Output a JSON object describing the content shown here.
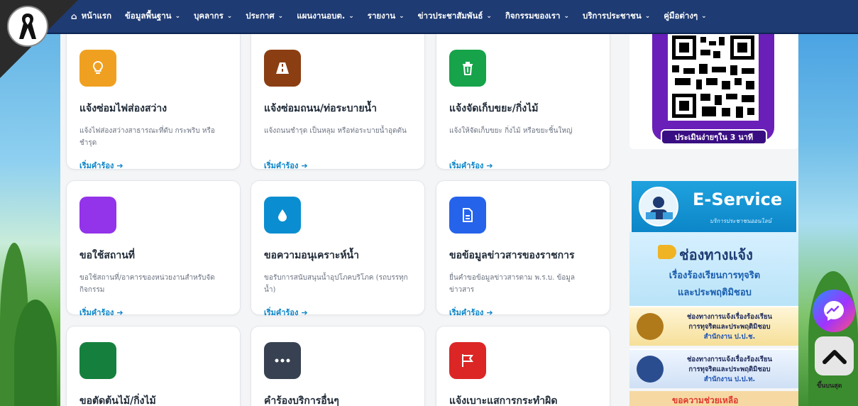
{
  "nav": {
    "home": "หน้าแรก",
    "items": [
      "ข้อมูลพื้นฐาน",
      "บุคลากร",
      "ประกาศ",
      "แผนงานอบต.",
      "รายงาน",
      "ข่าวประชาสัมพันธ์",
      "กิจกรรมของเรา",
      "บริการประชาชน",
      "คู่มือต่างๆ"
    ]
  },
  "services": [
    {
      "title": "แจ้งซ่อมไฟส่องสว่าง",
      "desc": "แจ้งไฟส่องสว่างสาธารณะที่ดับ กระพริบ หรือชำรุด",
      "cta": "เริ่มคำร้อง",
      "icon": "lightbulb-icon",
      "color": "#f0a020"
    },
    {
      "title": "แจ้งซ่อมถนน/ท่อระบายน้ำ",
      "desc": "แจ้งถนนชำรุด เป็นหลุม หรือท่อระบายน้ำอุดตัน",
      "cta": "เริ่มคำร้อง",
      "icon": "road-icon",
      "color": "#8b3e12"
    },
    {
      "title": "แจ้งจัดเก็บขยะ/กิ่งไม้",
      "desc": "แจ้งให้จัดเก็บขยะ กิ่งไม้ หรือขยะชิ้นใหญ่",
      "cta": "เริ่มคำร้อง",
      "icon": "trash-icon",
      "color": "#16a34a"
    },
    {
      "title": "ขอใช้สถานที่",
      "desc": "ขอใช้สถานที่/อาคารของหน่วยงานสำหรับจัดกิจกรรม",
      "cta": "เริ่มคำร้อง",
      "icon": "building-icon",
      "color": "#9333ea"
    },
    {
      "title": "ขอความอนุเคราะห์น้ำ",
      "desc": "ขอรับการสนับสนุนน้ำอุปโภคบริโภค (รถบรรทุกน้ำ)",
      "cta": "เริ่มคำร้อง",
      "icon": "water-drop-icon",
      "color": "#0b8ed1"
    },
    {
      "title": "ขอข้อมูลข่าวสารของราชการ",
      "desc": "ยื่นคำขอข้อมูลข่าวสารตาม พ.ร.บ. ข้อมูลข่าวสาร",
      "cta": "เริ่มคำร้อง",
      "icon": "document-icon",
      "color": "#2563eb"
    },
    {
      "title": "ขอตัดต้นไม้/กิ่งไม้",
      "desc": "",
      "cta": "",
      "icon": "tree-icon",
      "color": "#15803d"
    },
    {
      "title": "คำร้องบริการอื่นๆ",
      "desc": "",
      "cta": "",
      "icon": "ellipsis-icon",
      "color": "#374151"
    },
    {
      "title": "แจ้งเบาะแสการกระทำผิด",
      "desc": "",
      "cta": "",
      "icon": "flag-icon",
      "color": "#dc2626"
    }
  ],
  "sidebar": {
    "qr_caption": "ประเมินง่ายๆใน 3 นาที",
    "eservice_title": "E-Service",
    "eservice_sub": "บริการประชาชนออนไลน์",
    "complaint_line1": "ช่องทางแจ้ง",
    "complaint_line2": "เรื่องร้องเรียนการทุจริต",
    "complaint_line3": "และประพฤติมิชอบ",
    "banner1": [
      "ช่องทางการแจ้งเรื่องร้องเรียน",
      "การทุจริตและประพฤติมิชอบ",
      "สำนักงาน ป.ป.ช."
    ],
    "banner2": [
      "ช่องทางการแจ้งเรื่องร้องเรียน",
      "การทุจริตและประพฤติมิชอบ",
      "สำนักงาน ป.ป.ท."
    ],
    "banner3": "ขอความช่วยเหลือ"
  },
  "floating": {
    "to_top_label": "ขึ้นบนสุด"
  }
}
